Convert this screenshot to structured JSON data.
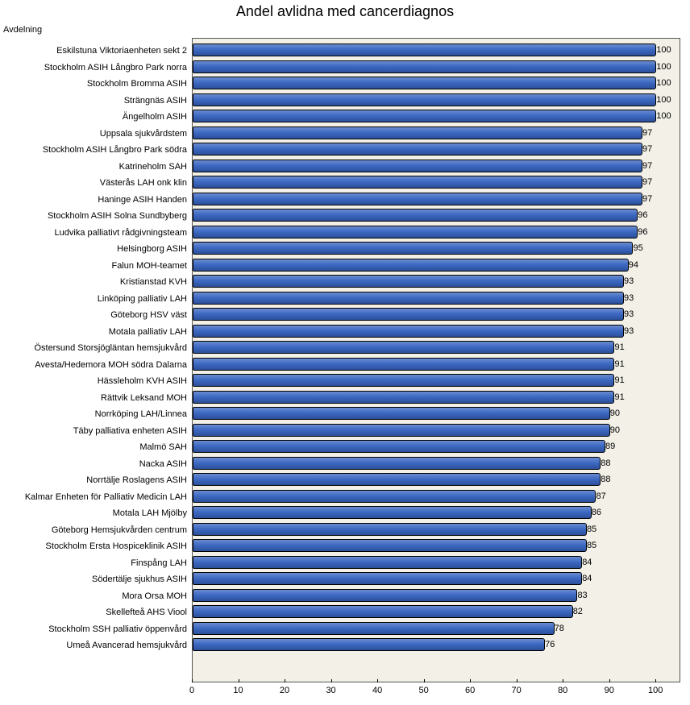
{
  "chart_data": {
    "type": "bar",
    "orientation": "horizontal",
    "title": "Andel avlidna med cancerdiagnos",
    "ylabel": "Avdelning",
    "xlabel": "",
    "xlim": [
      0,
      105
    ],
    "x_ticks": [
      0,
      10,
      20,
      30,
      40,
      50,
      60,
      70,
      80,
      90,
      100
    ],
    "categories": [
      "Eskilstuna Viktoriaenheten sekt 2",
      "Stockholm ASIH Långbro Park norra",
      "Stockholm Bromma ASIH",
      "Strängnäs ASIH",
      "Ängelholm ASIH",
      "Uppsala sjukvårdstem",
      "Stockholm ASIH Långbro Park södra",
      "Katrineholm SAH",
      "Västerås LAH onk klin",
      "Haninge ASIH Handen",
      "Stockholm  ASIH Solna Sundbyberg",
      "Ludvika palliativt rådgivningsteam",
      "Helsingborg ASIH",
      "Falun MOH-teamet",
      "Kristianstad KVH",
      "Linköping palliativ LAH",
      "Göteborg HSV väst",
      "Motala palliativ LAH",
      "Östersund Storsjögläntan hemsjukvård",
      "Avesta/Hedemora MOH södra Dalarna",
      "Hässleholm KVH ASIH",
      "Rättvik Leksand MOH",
      "Norrköping LAH/Linnea",
      "Täby palliativa enheten ASIH",
      "Malmö SAH",
      "Nacka ASIH",
      "Norrtälje Roslagens ASIH",
      "Kalmar Enheten för Palliativ Medicin LAH",
      "Motala LAH Mjölby",
      "Göteborg Hemsjukvården centrum",
      "Stockholm Ersta Hospiceklinik ASIH",
      "Finspång LAH",
      "Södertälje sjukhus ASIH",
      "Mora Orsa MOH",
      "Skellefteå AHS Viool",
      "Stockholm SSH palliativ öppenvård",
      "Umeå Avancerad hemsjukvård"
    ],
    "values": [
      100,
      100,
      100,
      100,
      100,
      97,
      97,
      97,
      97,
      97,
      96,
      96,
      95,
      94,
      93,
      93,
      93,
      93,
      91,
      91,
      91,
      91,
      90,
      90,
      89,
      88,
      88,
      87,
      86,
      85,
      85,
      84,
      84,
      83,
      82,
      78,
      76
    ]
  }
}
